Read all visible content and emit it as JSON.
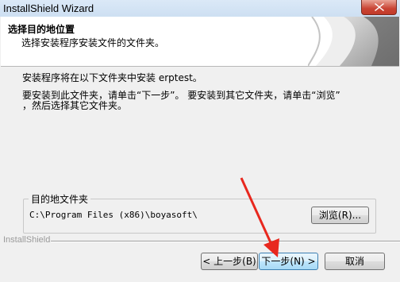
{
  "window": {
    "title": "InstallShield Wizard"
  },
  "header": {
    "title": "选择目的地位置",
    "subtitle": "选择安装程序安装文件的文件夹。"
  },
  "body": {
    "line1": "安装程序将在以下文件夹中安装 erptest。",
    "line2": "要安装到此文件夹，请单击“下一步”。 要安装到其它文件夹，请单击“浏览”",
    "line3": "，然后选择其它文件夹。"
  },
  "destination": {
    "group_label": "目的地文件夹",
    "path": "C:\\Program Files (x86)\\boyasoft\\",
    "browse_label": "浏览(R)..."
  },
  "footer": {
    "brand": "InstallShield",
    "back_label": "< 上一步(B)",
    "next_label": "下一步(N) >",
    "cancel_label": "取消"
  },
  "colors": {
    "annotation_arrow": "#e8281e",
    "close_button": "#c94434"
  },
  "icons": {
    "close": "close-icon"
  }
}
